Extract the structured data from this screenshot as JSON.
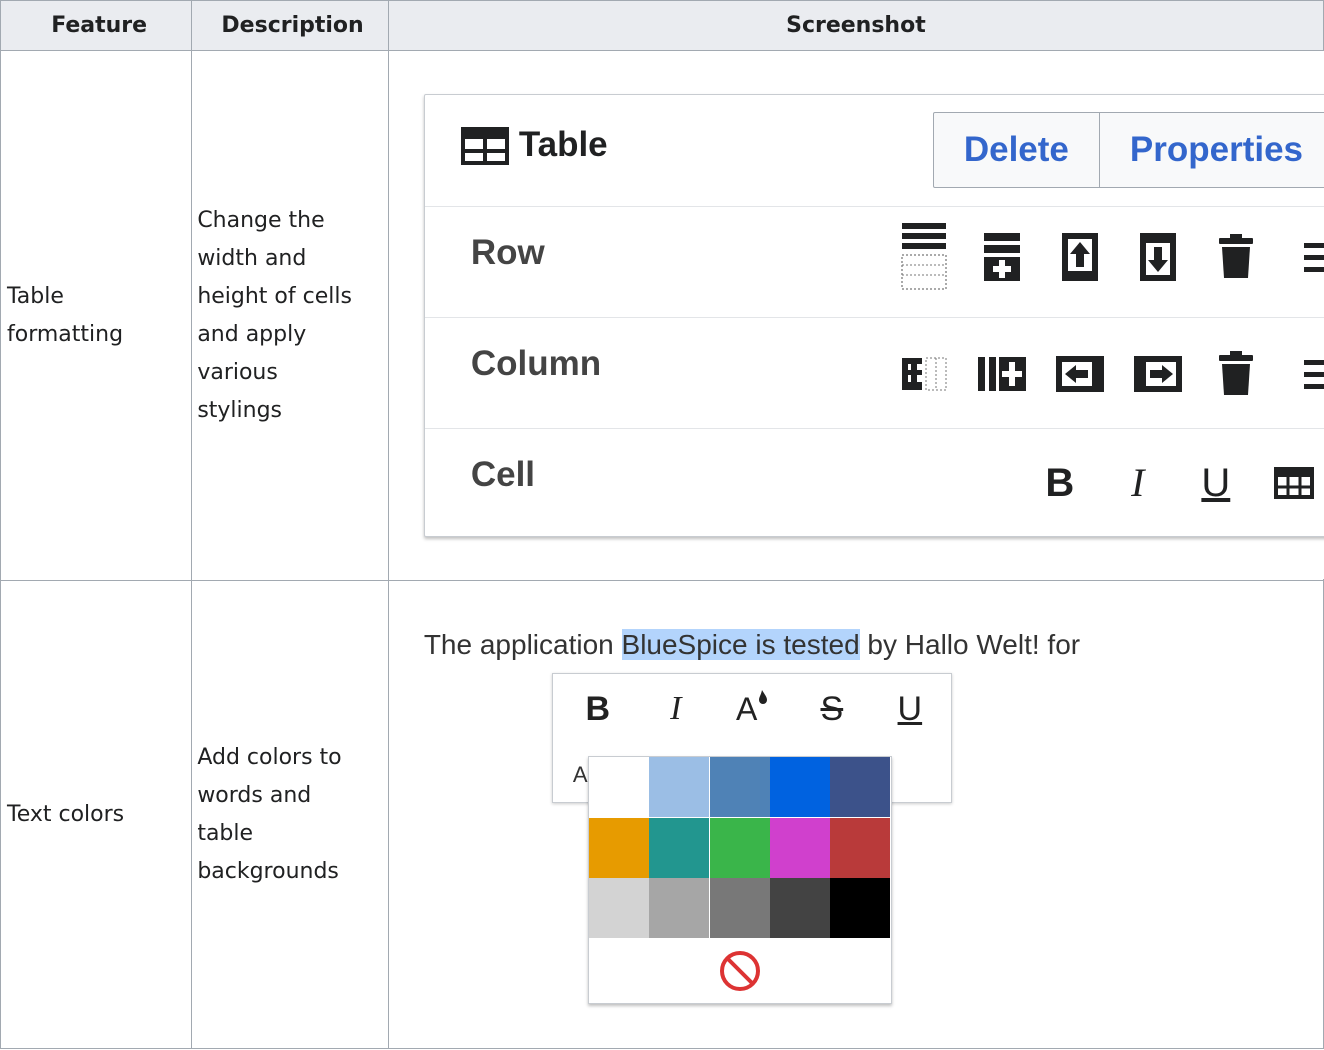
{
  "headers": [
    "Feature",
    "Description",
    "Screenshot"
  ],
  "rows": [
    {
      "feature": "Table\nformatting",
      "description": "Change the\nwidth and\nheight of cells\nand apply\nvarious\nstylings"
    },
    {
      "feature": "Text colors",
      "description": "Add colors to\nwords and\ntable\nbackgrounds"
    }
  ],
  "table_editor": {
    "title": "Table",
    "title_icon": "table-icon",
    "buttons": [
      "Delete",
      "Properties"
    ],
    "row_label": "Row",
    "column_label": "Column",
    "cell_label": "Cell",
    "row_icons": [
      "row-caption-icon",
      "insert-row-icon",
      "move-row-up-icon",
      "move-row-down-icon",
      "delete-icon",
      "more-icon"
    ],
    "column_icons": [
      "column-caption-icon",
      "insert-column-icon",
      "move-column-left-icon",
      "move-column-right-icon",
      "delete-icon",
      "more-icon"
    ],
    "cell_format": [
      "B",
      "I",
      "U"
    ],
    "cell_icons": [
      "merge-cells-icon"
    ],
    "accent_color": "#3366cc"
  },
  "text_colors": {
    "sentence_before": "The application ",
    "sentence_selected": "BlueSpice is tested",
    "sentence_after": " by Hallo Welt! for",
    "toolbar": [
      "B",
      "I",
      "A",
      "S",
      "U"
    ],
    "toolbar_icons": [
      "bold-icon",
      "italic-icon",
      "text-color-icon",
      "strikethrough-icon",
      "underline-icon"
    ],
    "second_row_fragment": "A",
    "swatches": [
      "#ffffff",
      "#9bbee5",
      "#4f82b6",
      "#0062e0",
      "#3c528a",
      "#e79b00",
      "#22968f",
      "#3ab54a",
      "#d040cd",
      "#b93a3a",
      "#d3d3d3",
      "#a6a6a6",
      "#787878",
      "#434343",
      "#000000"
    ],
    "clear_icon": "no-color-icon",
    "clear_color": "#d33"
  }
}
